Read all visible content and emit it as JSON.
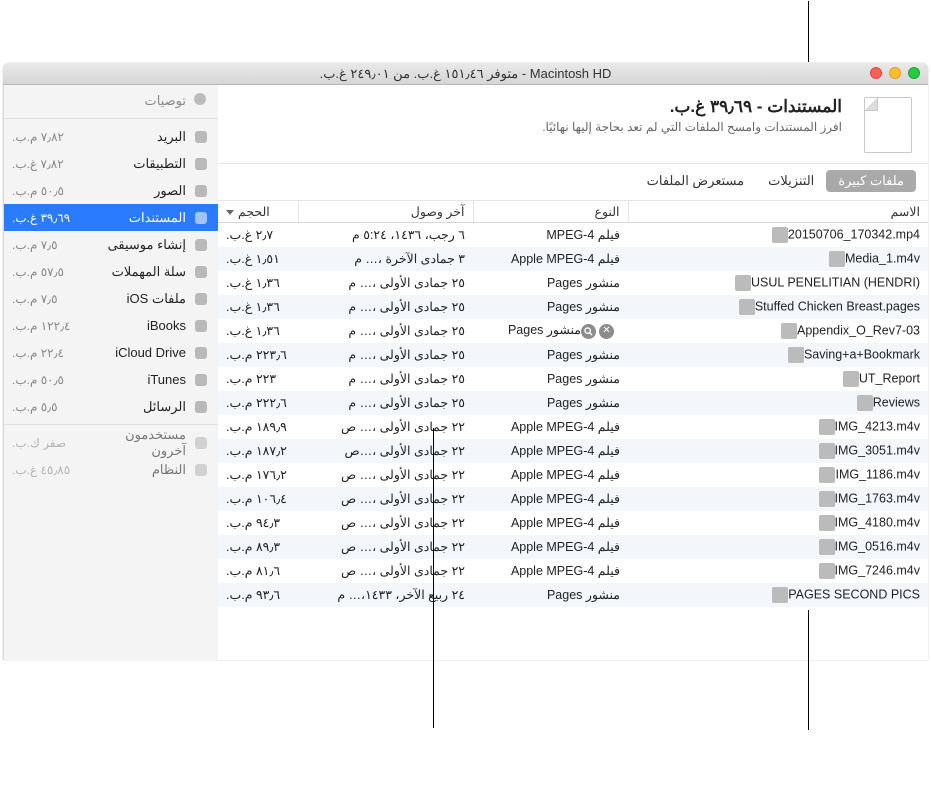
{
  "window": {
    "title": "Macintosh HD - متوفر ١٥١٫٤٦ غ.ب. من ٢٤٩٫٠١ غ.ب."
  },
  "sidebar": {
    "recs_label": "توصيات",
    "items": [
      {
        "label": "البريد",
        "size": "٧٫٨٢ م.ب.",
        "icon": "mail"
      },
      {
        "label": "التطبيقات",
        "size": "٧٫٨٢ غ.ب.",
        "icon": "apps"
      },
      {
        "label": "الصور",
        "size": "٥٠٫٥ م.ب.",
        "icon": "photos"
      },
      {
        "label": "المستندات",
        "size": "٣٩٫٦٩ غ.ب.",
        "icon": "docs",
        "selected": true
      },
      {
        "label": "إنشاء موسيقى",
        "size": "٧٫٥ م.ب.",
        "icon": "music-create"
      },
      {
        "label": "سلة المهملات",
        "size": "٥٧٫٥ م.ب.",
        "icon": "trash"
      },
      {
        "label": "ملفات iOS",
        "size": "٧٫٥ م.ب.",
        "icon": "ios"
      },
      {
        "label": "iBooks",
        "size": "١٢٢٫٤ م.ب.",
        "icon": "books"
      },
      {
        "label": "iCloud Drive",
        "size": "٢٢٫٤ م.ب.",
        "icon": "cloud"
      },
      {
        "label": "iTunes",
        "size": "٥٠٫٥ م.ب.",
        "icon": "itunes"
      },
      {
        "label": "الرسائل",
        "size": "٥٫٥ م.ب.",
        "icon": "messages"
      }
    ],
    "footer": [
      {
        "label": "مستخدمون آخرون",
        "size": "صفر ك.ب.",
        "icon": "users"
      },
      {
        "label": "النظام",
        "size": "٤٥٫٨٥ غ.ب.",
        "icon": "system"
      }
    ]
  },
  "header": {
    "title_prefix": "المستندات",
    "title_size": "٣٩٫٦٩ غ.ب.",
    "subtitle": "افرز المستندات وامسح الملفات التي لم تعد بحاجة إليها نهائيًا."
  },
  "tabs": [
    {
      "label": "ملفات كبيرة",
      "active": true
    },
    {
      "label": "التنزيلات",
      "active": false
    },
    {
      "label": "مستعرض الملفات",
      "active": false
    }
  ],
  "columns": {
    "name": "الاسم",
    "kind": "النوع",
    "accessed": "آخر وصول",
    "size": "الحجم"
  },
  "rows": [
    {
      "name": "20150706_170342.mp4",
      "kind": "فيلم MPEG-4",
      "date": "٦ رجب، ١٤٣٦، ٥:٢٤ م",
      "size": "٢٫٧ غ.ب."
    },
    {
      "name": "Media_1.m4v",
      "kind": "فيلم Apple MPEG-4",
      "date": "٣ جمادى الآخرة ،… م",
      "size": "١٫٥١ غ.ب."
    },
    {
      "name": "USUL PENELITIAN (HENDRI)",
      "kind": "منشور Pages",
      "date": "٢٥ جمادى الأولى ،… م",
      "size": "١٫٣٦ غ.ب."
    },
    {
      "name": "Stuffed Chicken Breast.pages",
      "kind": "منشور Pages",
      "date": "٢٥ جمادى الأولى ،… م",
      "size": "١٫٣٦ غ.ب."
    },
    {
      "name": "Appendix_O_Rev7-03",
      "kind": "منشور Pages",
      "date": "٢٥ جمادى الأولى ،… م",
      "size": "١٫٣٦ غ.ب.",
      "hover": true
    },
    {
      "name": "Saving+a+Bookmark",
      "kind": "منشور Pages",
      "date": "٢٥ جمادى الأولى ،… م",
      "size": "٢٢٣٫٦ م.ب."
    },
    {
      "name": "UT_Report",
      "kind": "منشور Pages",
      "date": "٢٥ جمادى الأولى ،… م",
      "size": "٢٢٣ م.ب."
    },
    {
      "name": "Reviews",
      "kind": "منشور Pages",
      "date": "٢٥ جمادى الأولى ،… م",
      "size": "٢٢٢٫٦ م.ب."
    },
    {
      "name": "IMG_4213.m4v",
      "kind": "فيلم Apple MPEG-4",
      "date": "٢٢ جمادى الأولى ،… ص",
      "size": "١٨٩٫٩ م.ب."
    },
    {
      "name": "IMG_3051.m4v",
      "kind": "فيلم Apple MPEG-4",
      "date": "٢٢ جمادى الأولى ،…ص",
      "size": "١٨٧٫٢ م.ب."
    },
    {
      "name": "IMG_1186.m4v",
      "kind": "فيلم Apple MPEG-4",
      "date": "٢٢ جمادى الأولى ،… ص",
      "size": "١٧٦٫٢ م.ب."
    },
    {
      "name": "IMG_1763.m4v",
      "kind": "فيلم Apple MPEG-4",
      "date": "٢٢ جمادى الأولى ،… ص",
      "size": "١٠٦٫٤ م.ب."
    },
    {
      "name": "IMG_4180.m4v",
      "kind": "فيلم Apple MPEG-4",
      "date": "٢٢ جمادى الأولى ،… ص",
      "size": "٩٤٫٣ م.ب."
    },
    {
      "name": "IMG_0516.m4v",
      "kind": "فيلم Apple MPEG-4",
      "date": "٢٢ جمادى الأولى ،… ص",
      "size": "٨٩٫٣ م.ب."
    },
    {
      "name": "IMG_7246.m4v",
      "kind": "فيلم Apple MPEG-4",
      "date": "٢٢ جمادى الأولى ،… ص",
      "size": "٨١٫٦ م.ب."
    },
    {
      "name": "PAGES SECOND PICS",
      "kind": "منشور Pages",
      "date": "٢٤ ربيع الآخر، ١٤٣٣،… م",
      "size": "٩٣٫٦ م.ب."
    }
  ]
}
